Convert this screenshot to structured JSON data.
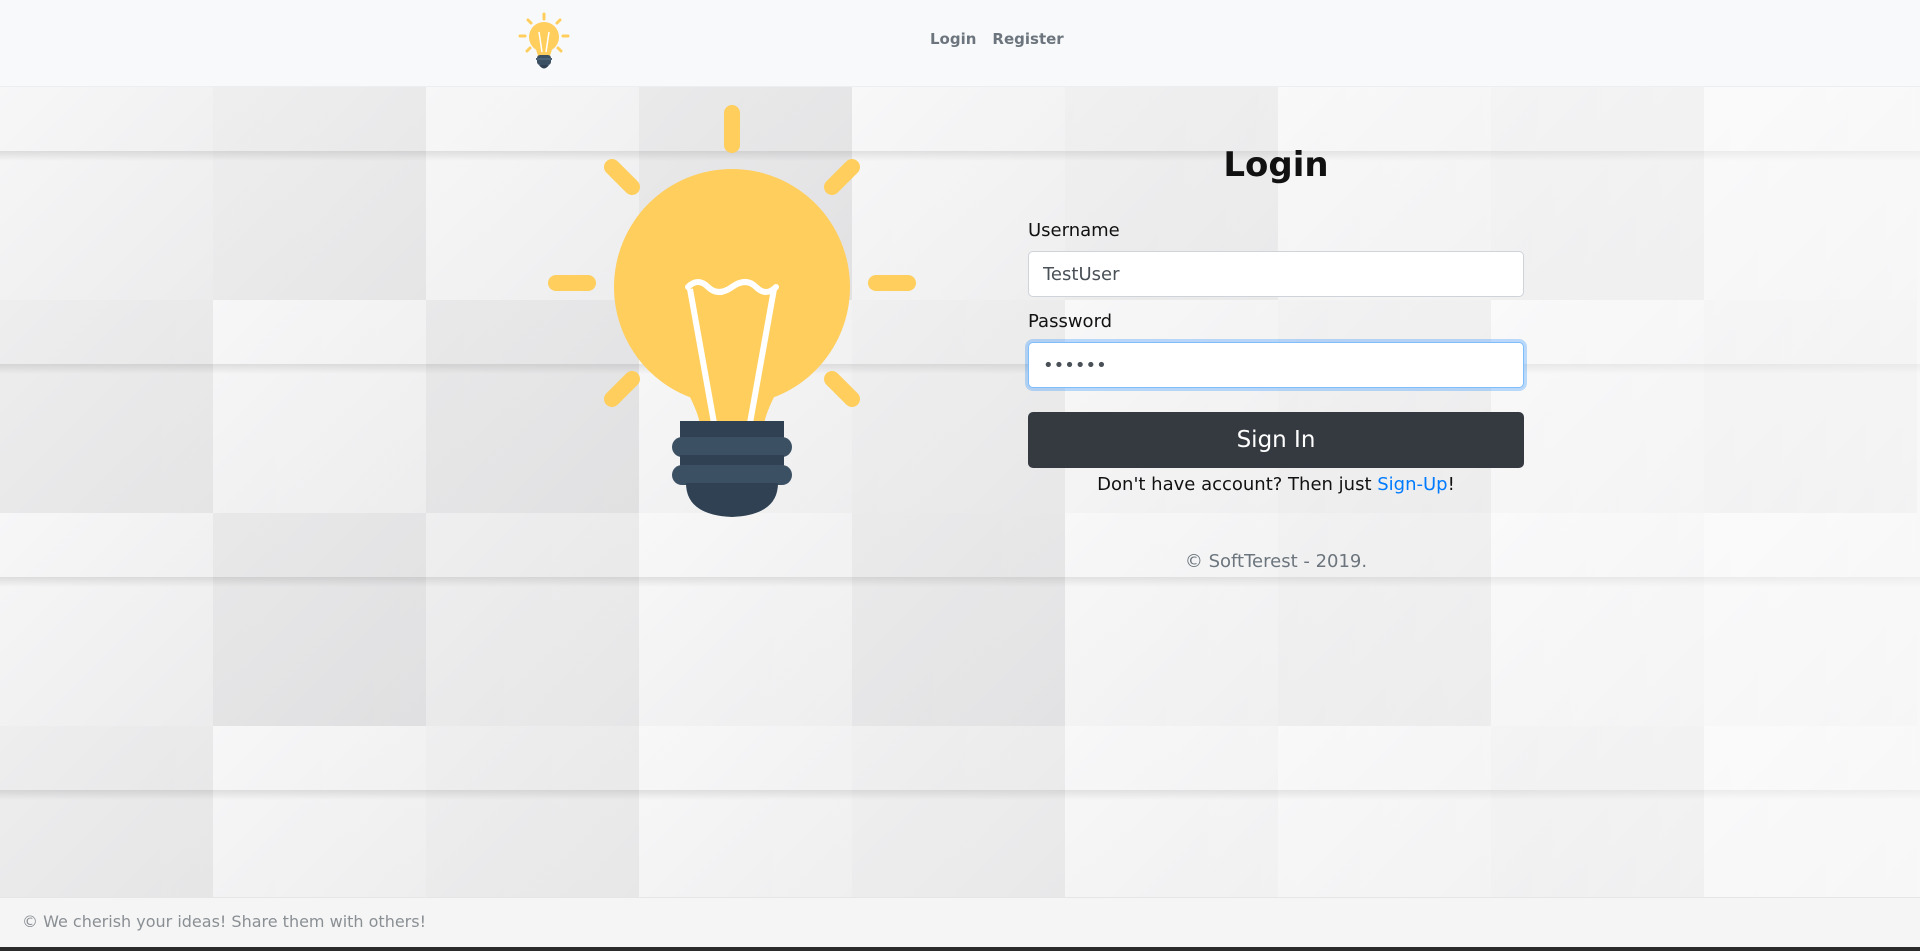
{
  "navbar": {
    "logo_icon": "lightbulb-icon",
    "links": [
      {
        "label": "Login"
      },
      {
        "label": "Register"
      }
    ]
  },
  "hero": {
    "image_icon": "lightbulb-icon",
    "bulb_color": "#ffce5c",
    "base_color": "#3c5064"
  },
  "login": {
    "title": "Login",
    "username_label": "Username",
    "username_value": "TestUser",
    "password_label": "Password",
    "password_value": "••••••",
    "signin_label": "Sign In",
    "signup_prefix": "Don't have account? Then just ",
    "signup_link": "Sign-Up",
    "signup_suffix": "!",
    "copyright": "© SoftTerest - 2019."
  },
  "footer": {
    "text": "© We cherish your ideas! Share them with others!"
  },
  "colors": {
    "primary_button": "#343a40",
    "link": "#007bff",
    "focus_border": "#80bdff"
  }
}
